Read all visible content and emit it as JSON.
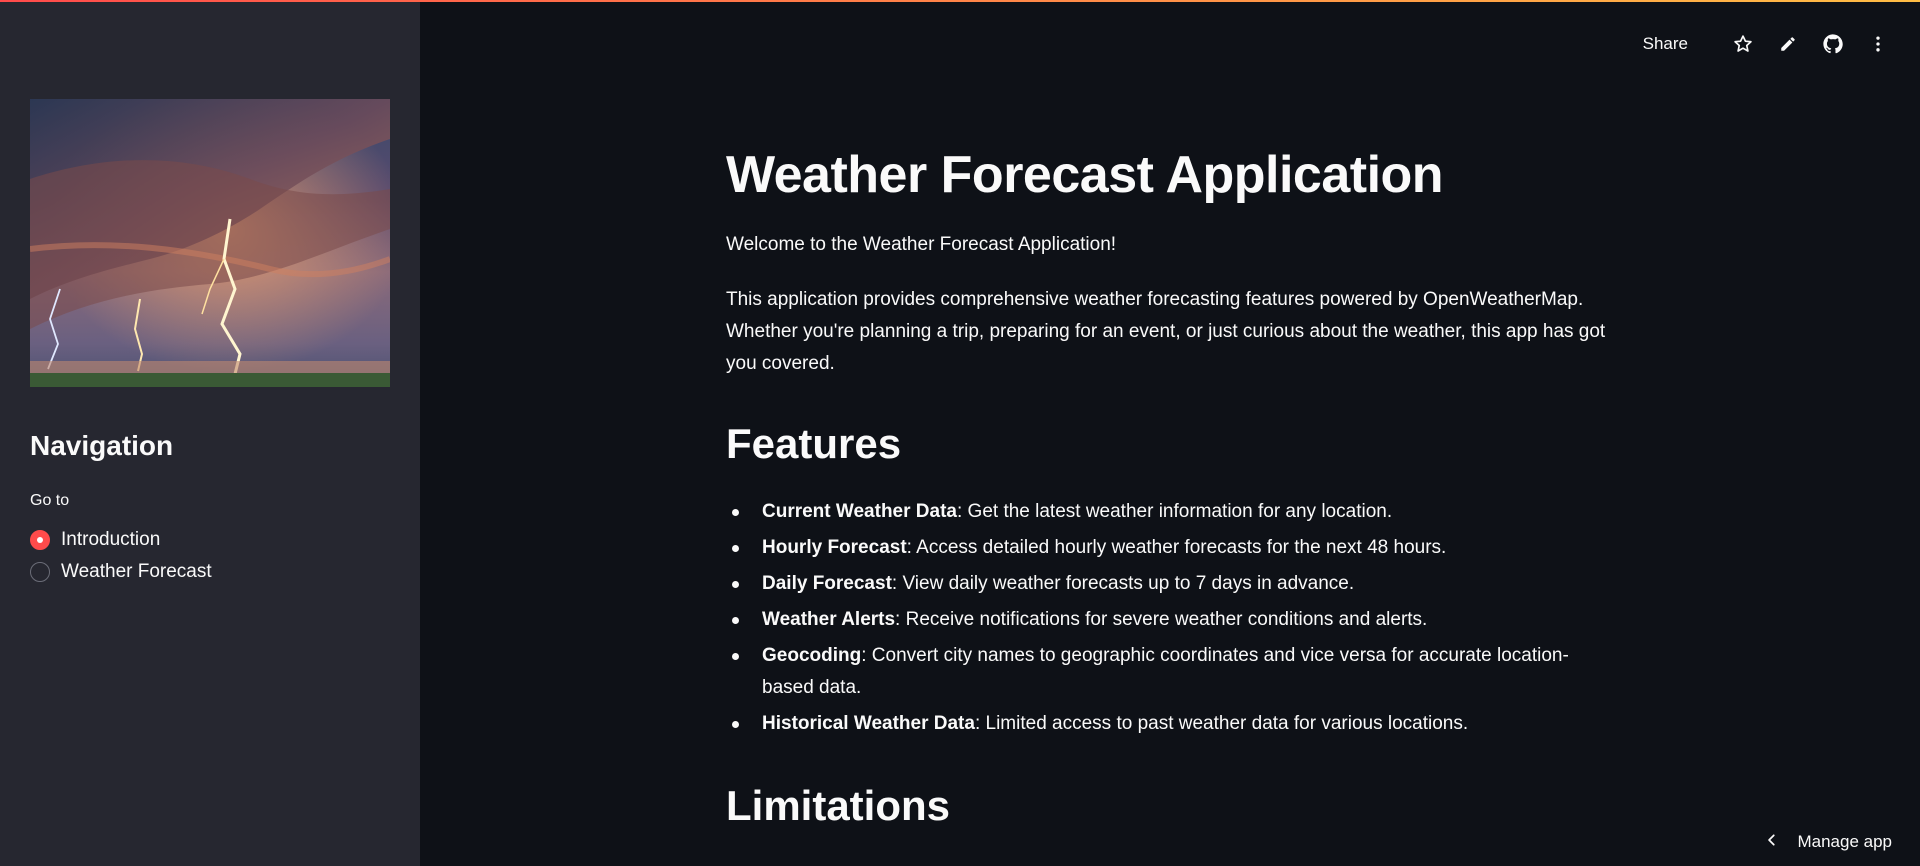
{
  "sidebar": {
    "nav_title": "Navigation",
    "radio_label": "Go to",
    "options": [
      {
        "label": "Introduction",
        "selected": true
      },
      {
        "label": "Weather Forecast",
        "selected": false
      }
    ]
  },
  "header": {
    "share_label": "Share",
    "icons": [
      "star-icon",
      "pencil-icon",
      "github-icon",
      "more-vertical-icon"
    ]
  },
  "main": {
    "title": "Weather Forecast Application",
    "welcome": "Welcome to the Weather Forecast Application!",
    "intro": "This application provides comprehensive weather forecasting features powered by OpenWeatherMap. Whether you're planning a trip, preparing for an event, or just curious about the weather, this app has got you covered.",
    "features_heading": "Features",
    "features": [
      {
        "name": "Current Weather Data",
        "desc": ": Get the latest weather information for any location."
      },
      {
        "name": "Hourly Forecast",
        "desc": ": Access detailed hourly weather forecasts for the next 48 hours."
      },
      {
        "name": "Daily Forecast",
        "desc": ": View daily weather forecasts up to 7 days in advance."
      },
      {
        "name": "Weather Alerts",
        "desc": ": Receive notifications for severe weather conditions and alerts."
      },
      {
        "name": "Geocoding",
        "desc": ": Convert city names to geographic coordinates and vice versa for accurate location-based data."
      },
      {
        "name": "Historical Weather Data",
        "desc": ": Limited access to past weather data for various locations."
      }
    ],
    "limitations_heading": "Limitations"
  },
  "footer": {
    "manage_label": "Manage app"
  },
  "colors": {
    "accent": "#ff4b4b",
    "background": "#0e1117",
    "sidebar": "#262730",
    "text": "#fafafa"
  }
}
